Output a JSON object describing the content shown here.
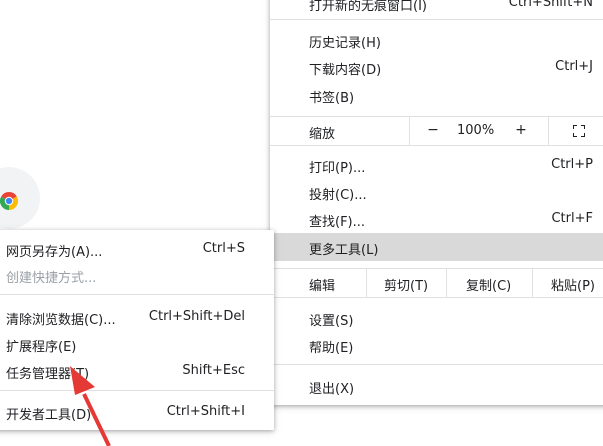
{
  "main_menu": {
    "top_item": {
      "label": "打开新的无痕窗口(I)",
      "shortcut": "Ctrl+Shift+N"
    },
    "history": {
      "label": "历史记录(H)"
    },
    "downloads": {
      "label": "下载内容(D)",
      "shortcut": "Ctrl+J"
    },
    "bookmarks": {
      "label": "书签(B)"
    },
    "zoom": {
      "label": "缩放",
      "minus": "−",
      "value": "100%",
      "plus": "+",
      "fullscreen_icon": "fullscreen-icon"
    },
    "print": {
      "label": "打印(P)...",
      "shortcut": "Ctrl+P"
    },
    "cast": {
      "label": "投射(C)..."
    },
    "find": {
      "label": "查找(F)...",
      "shortcut": "Ctrl+F"
    },
    "more_tools": {
      "label": "更多工具(L)"
    },
    "edit": {
      "label": "编辑",
      "cut": "剪切(T)",
      "copy": "复制(C)",
      "paste": "粘贴(P)"
    },
    "settings": {
      "label": "设置(S)"
    },
    "help": {
      "label": "帮助(E)"
    },
    "exit": {
      "label": "退出(X)"
    }
  },
  "sub_menu": {
    "save_page": {
      "label": "网页另存为(A)...",
      "shortcut": "Ctrl+S"
    },
    "create_shortcut": {
      "label": "创建快捷方式..."
    },
    "clear_data": {
      "label": "清除浏览数据(C)...",
      "shortcut": "Ctrl+Shift+Del"
    },
    "extensions": {
      "label": "扩展程序(E)"
    },
    "task_manager": {
      "label": "任务管理器(T)",
      "shortcut": "Shift+Esc"
    },
    "dev_tools": {
      "label": "开发者工具(D)",
      "shortcut": "Ctrl+Shift+I"
    }
  },
  "colors": {
    "highlight": "#d9d9d9",
    "arrow": "#e53935",
    "disabled_text": "#9aa0a6"
  }
}
